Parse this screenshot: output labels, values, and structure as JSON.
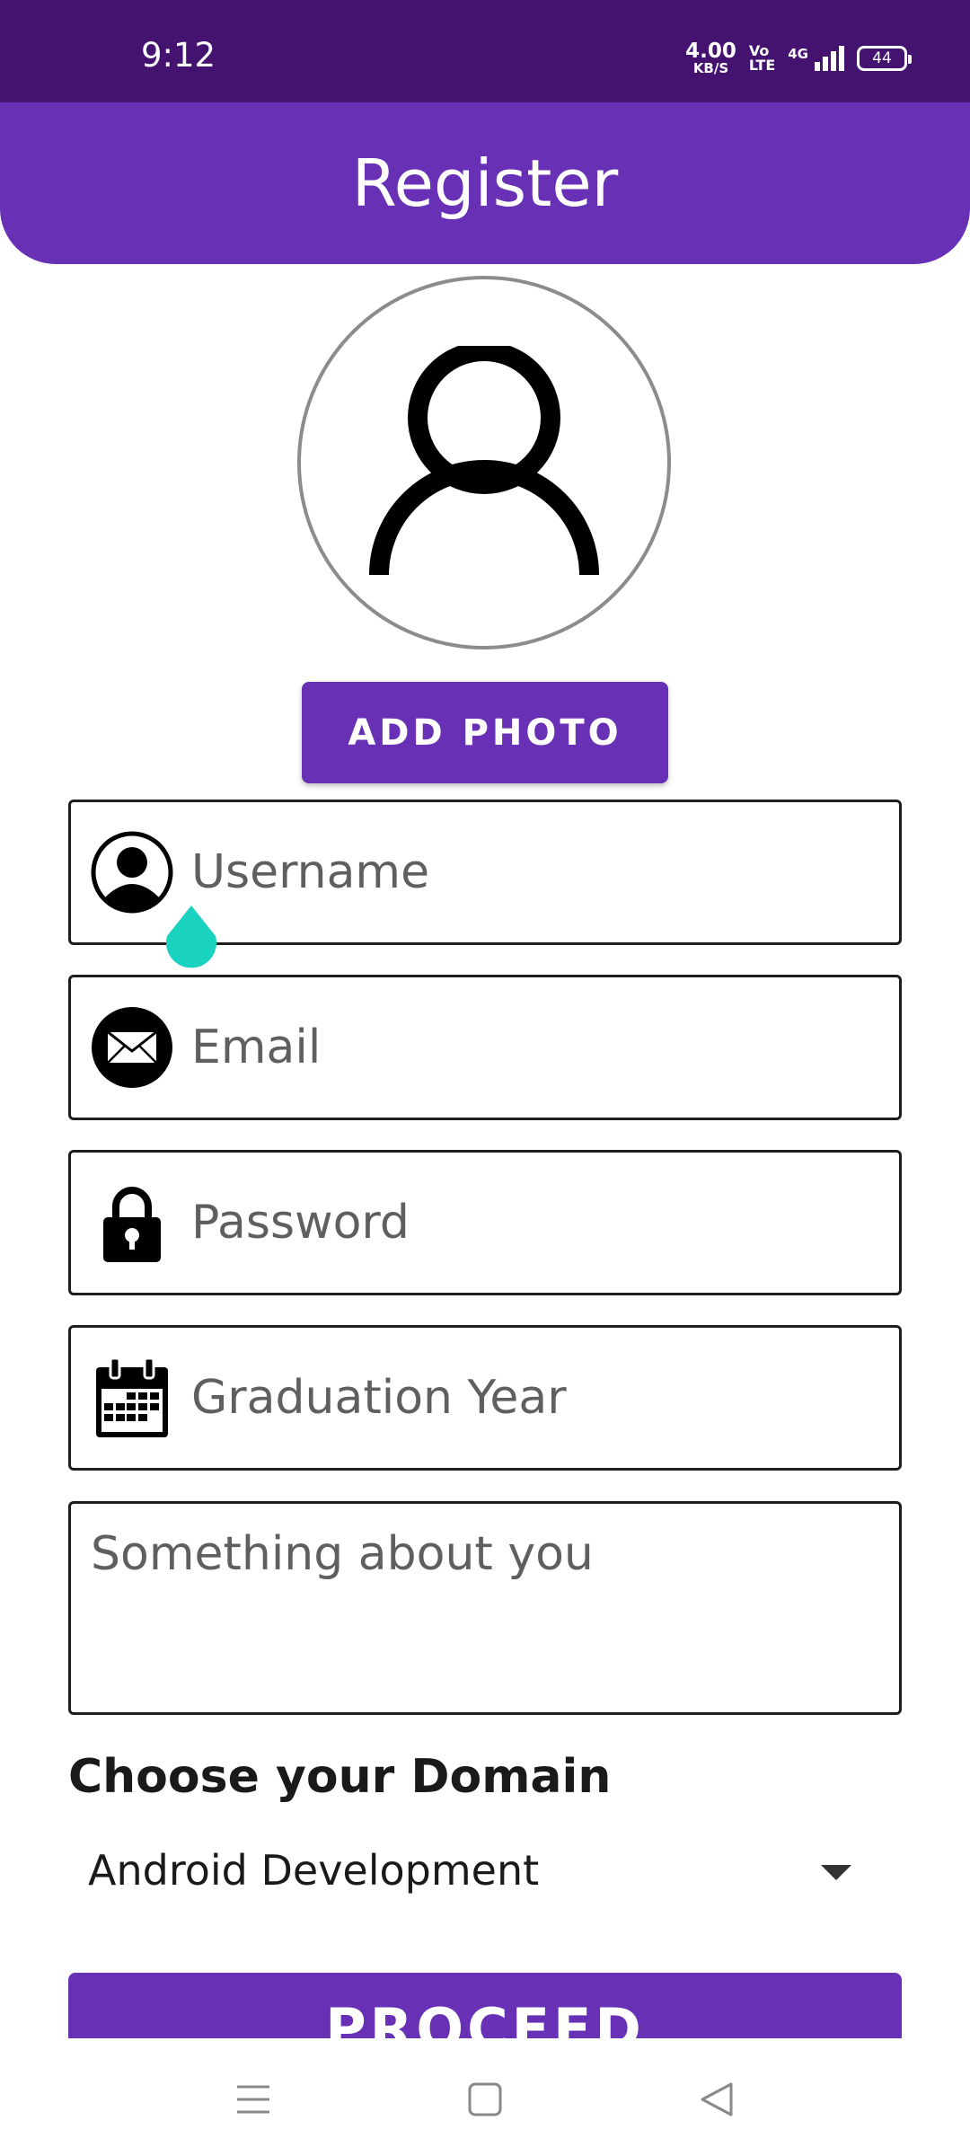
{
  "status_bar": {
    "time": "9:12",
    "net_speed_value": "4.00",
    "net_speed_unit": "KB/S",
    "volte_top": "Vo",
    "volte_bottom": "LTE",
    "network_type": "4G",
    "battery_level": "44"
  },
  "header": {
    "title": "Register"
  },
  "profile": {
    "avatar_icon": "person-outline-icon",
    "add_photo_label": "ADD PHOTO"
  },
  "form": {
    "username_placeholder": "Username",
    "email_placeholder": "Email",
    "password_placeholder": "Password",
    "graduation_placeholder": "Graduation Year",
    "about_placeholder": "Something about you"
  },
  "domain": {
    "label": "Choose your Domain",
    "selected": "Android Development"
  },
  "proceed_label": "PROCEED",
  "colors": {
    "primary": "#6730b5",
    "status_bar": "#44126f",
    "cursor_handle": "#19d3c0"
  },
  "icons": [
    "user-icon",
    "email-icon",
    "lock-icon",
    "calendar-icon",
    "dropdown-arrow-icon",
    "menu-icon",
    "home-icon",
    "back-icon"
  ]
}
